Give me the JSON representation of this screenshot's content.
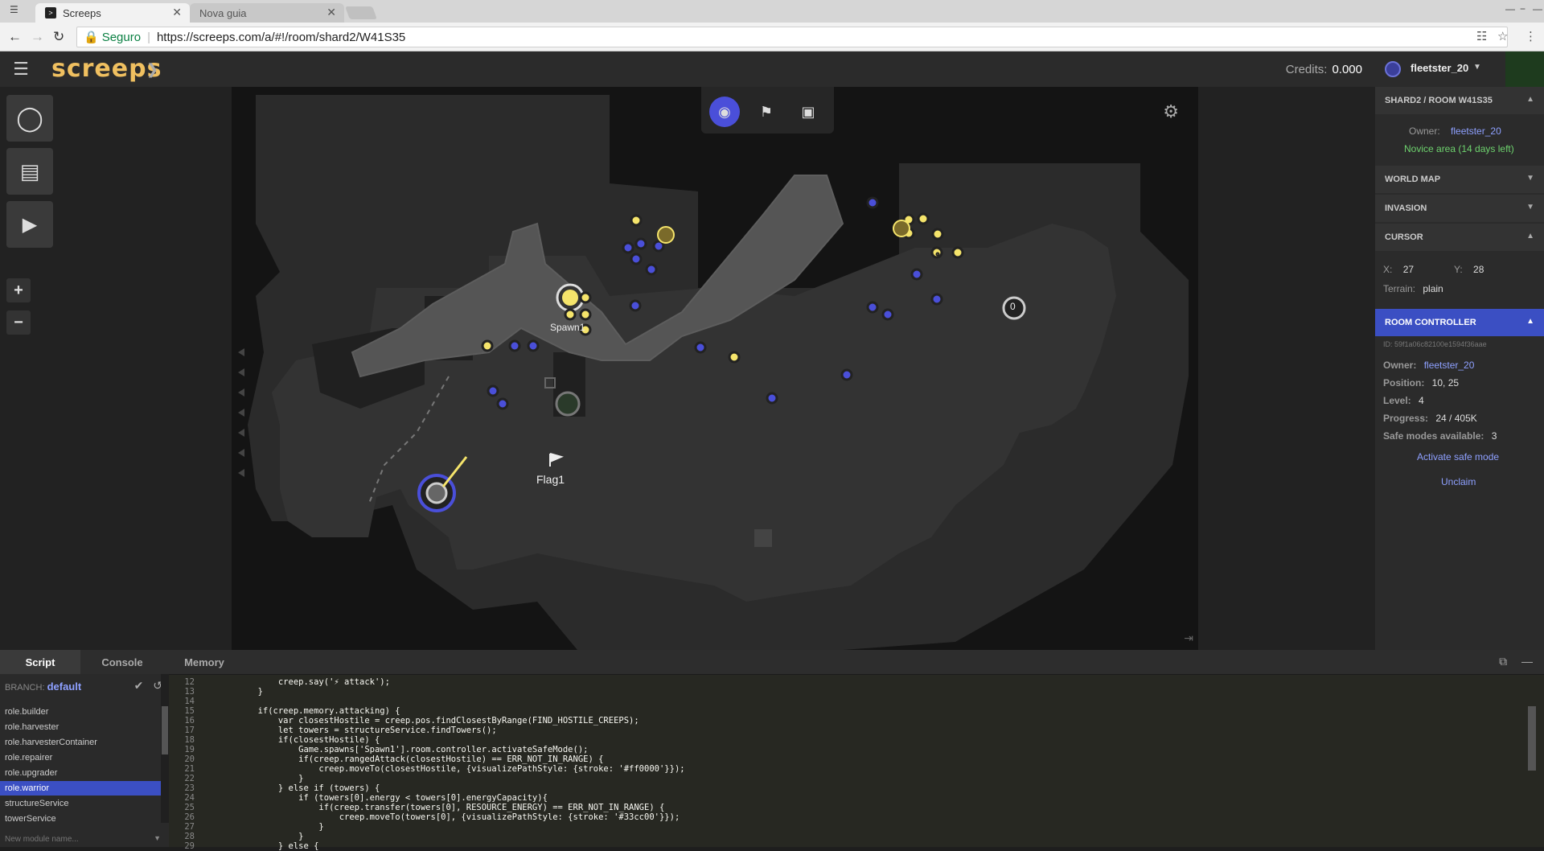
{
  "browser": {
    "tabs": [
      {
        "label": "Screeps",
        "active": true
      },
      {
        "label": "Nova guia",
        "active": false
      }
    ],
    "secure_label": "Seguro",
    "url": "https://screeps.com/a/#!/room/shard2/W41S35"
  },
  "header": {
    "logo": "screeps",
    "credits_label": "Credits:",
    "credits_value": "0.000"
  },
  "map": {
    "spawn_label": "Spawn1",
    "flag_label": "Flag1",
    "view_modes": [
      "eye-icon",
      "flag-icon",
      "cube-icon"
    ],
    "controller_level": "0"
  },
  "user": {
    "name": "fleetster_20"
  },
  "panel": {
    "room_title": "SHARD2 / ROOM W41S35",
    "owner_label": "Owner:",
    "owner_name": "fleetster_20",
    "novice_text": "Novice area (14 days left)",
    "world_map": "WORLD MAP",
    "invasion": "INVASION",
    "cursor": "CURSOR",
    "cursor_x_label": "X:",
    "cursor_x": "27",
    "cursor_y_label": "Y:",
    "cursor_y": "28",
    "terrain_label": "Terrain:",
    "terrain": "plain",
    "room_controller": "ROOM CONTROLLER",
    "controller_id": "ID: 59f1a06c82100e1594f36aae",
    "rc_owner_label": "Owner:",
    "rc_owner": "fleetster_20",
    "position_label": "Position:",
    "position": "10, 25",
    "level_label": "Level:",
    "level": "4",
    "progress_label": "Progress:",
    "progress": "24 / 405K",
    "safe_modes_label": "Safe modes available:",
    "safe_modes": "3",
    "activate_safe_mode": "Activate safe mode",
    "unclaim": "Unclaim"
  },
  "bottom": {
    "tabs": [
      "Script",
      "Console",
      "Memory"
    ],
    "branch_label": "BRANCH:",
    "branch": "default",
    "modules": [
      "role.builder",
      "role.harvester",
      "role.harvesterContainer",
      "role.repairer",
      "role.upgrader",
      "role.warrior",
      "structureService",
      "towerService"
    ],
    "active_module": "role.warrior",
    "new_module_placeholder": "New module name..."
  },
  "code_lines": [
    {
      "n": "12",
      "t": "            creep.say('⚡ attack');"
    },
    {
      "n": "13",
      "t": "        }"
    },
    {
      "n": "14",
      "t": ""
    },
    {
      "n": "15",
      "t": "        if(creep.memory.attacking) {"
    },
    {
      "n": "16",
      "t": "            var closestHostile = creep.pos.findClosestByRange(FIND_HOSTILE_CREEPS);"
    },
    {
      "n": "17",
      "t": "            let towers = structureService.findTowers();"
    },
    {
      "n": "18",
      "t": "            if(closestHostile) {"
    },
    {
      "n": "19",
      "t": "                Game.spawns['Spawn1'].room.controller.activateSafeMode();"
    },
    {
      "n": "20",
      "t": "                if(creep.rangedAttack(closestHostile) == ERR_NOT_IN_RANGE) {"
    },
    {
      "n": "21",
      "t": "                    creep.moveTo(closestHostile, {visualizePathStyle: {stroke: '#ff0000'}});"
    },
    {
      "n": "22",
      "t": "                }"
    },
    {
      "n": "23",
      "t": "            } else if (towers) {"
    },
    {
      "n": "24",
      "t": "                if (towers[0].energy < towers[0].energyCapacity){"
    },
    {
      "n": "25",
      "t": "                    if(creep.transfer(towers[0], RESOURCE_ENERGY) == ERR_NOT_IN_RANGE) {"
    },
    {
      "n": "26",
      "t": "                        creep.moveTo(towers[0], {visualizePathStyle: {stroke: '#33cc00'}});"
    },
    {
      "n": "27",
      "t": "                    }"
    },
    {
      "n": "28",
      "t": "                }"
    },
    {
      "n": "29",
      "t": "            } else {"
    }
  ]
}
